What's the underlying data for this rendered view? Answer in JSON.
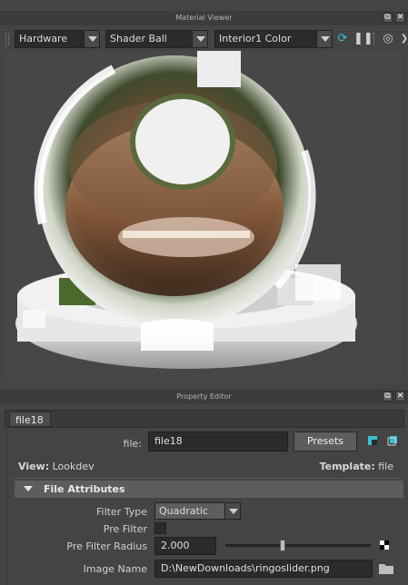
{
  "material_viewer": {
    "title": "Material Viewer",
    "renderer": "Hardware",
    "geometry": "Shader Ball",
    "environment": "Interior1 Color",
    "icons": [
      "refresh-icon",
      "pause-icon",
      "options-icon"
    ]
  },
  "property_editor": {
    "title": "Property Editor",
    "tab": "file18",
    "file_label": "file:",
    "file_value": "file18",
    "presets_label": "Presets",
    "view_label": "View:",
    "view_value": "Lookdev",
    "template_label": "Template:",
    "template_value": "file",
    "section_title": "File Attributes",
    "filter_type_label": "Filter Type",
    "filter_type_value": "Quadratic",
    "pre_filter_label": "Pre Filter",
    "pre_filter_checked": false,
    "pre_filter_radius_label": "Pre Filter Radius",
    "pre_filter_radius_value": "2.000",
    "pre_filter_radius_slider": 0.4,
    "image_name_label": "Image Name",
    "image_name_value": "D:\\NewDownloads\\ringoslider.png"
  },
  "colors": {
    "panel_bg": "#444444",
    "field_bg": "#2b2b2b",
    "section_bg": "#5d5d5d",
    "accent": "#36c1d8"
  }
}
